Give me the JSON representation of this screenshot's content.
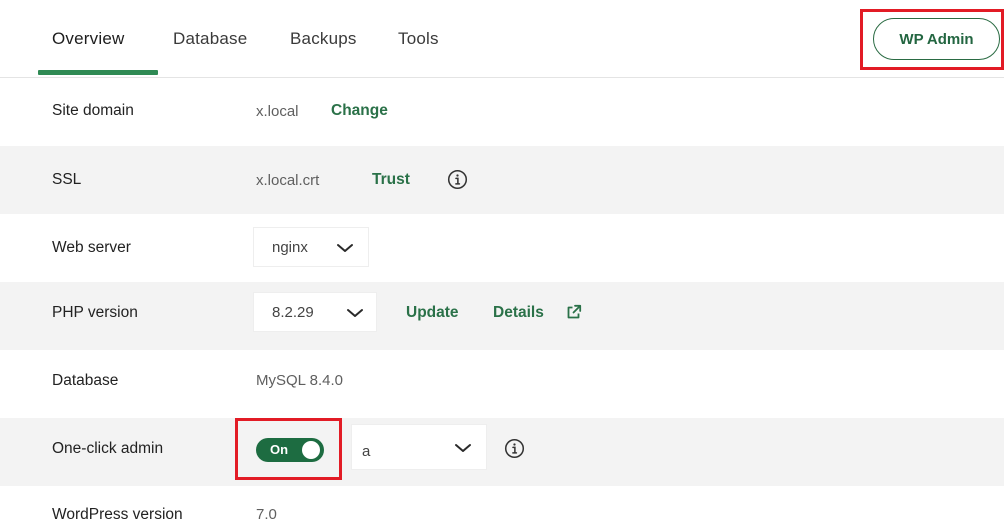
{
  "tabs": {
    "overview": "Overview",
    "database": "Database",
    "backups": "Backups",
    "tools": "Tools"
  },
  "wp_admin_label": "WP Admin",
  "rows": {
    "site_domain": {
      "label": "Site domain",
      "value": "x.local",
      "action": "Change"
    },
    "ssl": {
      "label": "SSL",
      "value": "x.local.crt",
      "action": "Trust"
    },
    "web_server": {
      "label": "Web server",
      "selected": "nginx"
    },
    "php_version": {
      "label": "PHP version",
      "selected": "8.2.29",
      "update": "Update",
      "details": "Details"
    },
    "database": {
      "label": "Database",
      "value": "MySQL 8.4.0"
    },
    "one_click_admin": {
      "label": "One-click admin",
      "toggle_label": "On",
      "toggle_state": "on",
      "user_selected": "a"
    },
    "wordpress_version": {
      "label": "WordPress version",
      "value": "7.0"
    }
  },
  "colors": {
    "accent_green": "#2a7148",
    "toggle_green": "#1d6c41",
    "highlight_red": "#e21b25",
    "row_shade": "#f3f3f3"
  },
  "icons": [
    "info-icon",
    "chevron-down-icon",
    "external-link-icon"
  ]
}
